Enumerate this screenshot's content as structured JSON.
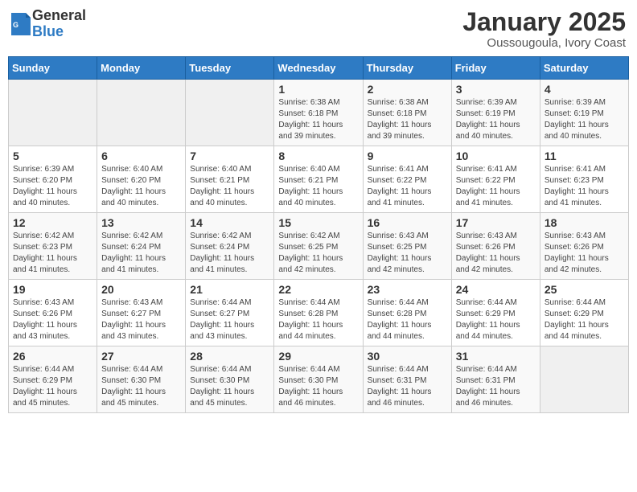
{
  "header": {
    "logo_general": "General",
    "logo_blue": "Blue",
    "title": "January 2025",
    "subtitle": "Oussougoula, Ivory Coast"
  },
  "weekdays": [
    "Sunday",
    "Monday",
    "Tuesday",
    "Wednesday",
    "Thursday",
    "Friday",
    "Saturday"
  ],
  "weeks": [
    [
      {
        "day": "",
        "info": ""
      },
      {
        "day": "",
        "info": ""
      },
      {
        "day": "",
        "info": ""
      },
      {
        "day": "1",
        "info": "Sunrise: 6:38 AM\nSunset: 6:18 PM\nDaylight: 11 hours\nand 39 minutes."
      },
      {
        "day": "2",
        "info": "Sunrise: 6:38 AM\nSunset: 6:18 PM\nDaylight: 11 hours\nand 39 minutes."
      },
      {
        "day": "3",
        "info": "Sunrise: 6:39 AM\nSunset: 6:19 PM\nDaylight: 11 hours\nand 40 minutes."
      },
      {
        "day": "4",
        "info": "Sunrise: 6:39 AM\nSunset: 6:19 PM\nDaylight: 11 hours\nand 40 minutes."
      }
    ],
    [
      {
        "day": "5",
        "info": "Sunrise: 6:39 AM\nSunset: 6:20 PM\nDaylight: 11 hours\nand 40 minutes."
      },
      {
        "day": "6",
        "info": "Sunrise: 6:40 AM\nSunset: 6:20 PM\nDaylight: 11 hours\nand 40 minutes."
      },
      {
        "day": "7",
        "info": "Sunrise: 6:40 AM\nSunset: 6:21 PM\nDaylight: 11 hours\nand 40 minutes."
      },
      {
        "day": "8",
        "info": "Sunrise: 6:40 AM\nSunset: 6:21 PM\nDaylight: 11 hours\nand 40 minutes."
      },
      {
        "day": "9",
        "info": "Sunrise: 6:41 AM\nSunset: 6:22 PM\nDaylight: 11 hours\nand 41 minutes."
      },
      {
        "day": "10",
        "info": "Sunrise: 6:41 AM\nSunset: 6:22 PM\nDaylight: 11 hours\nand 41 minutes."
      },
      {
        "day": "11",
        "info": "Sunrise: 6:41 AM\nSunset: 6:23 PM\nDaylight: 11 hours\nand 41 minutes."
      }
    ],
    [
      {
        "day": "12",
        "info": "Sunrise: 6:42 AM\nSunset: 6:23 PM\nDaylight: 11 hours\nand 41 minutes."
      },
      {
        "day": "13",
        "info": "Sunrise: 6:42 AM\nSunset: 6:24 PM\nDaylight: 11 hours\nand 41 minutes."
      },
      {
        "day": "14",
        "info": "Sunrise: 6:42 AM\nSunset: 6:24 PM\nDaylight: 11 hours\nand 41 minutes."
      },
      {
        "day": "15",
        "info": "Sunrise: 6:42 AM\nSunset: 6:25 PM\nDaylight: 11 hours\nand 42 minutes."
      },
      {
        "day": "16",
        "info": "Sunrise: 6:43 AM\nSunset: 6:25 PM\nDaylight: 11 hours\nand 42 minutes."
      },
      {
        "day": "17",
        "info": "Sunrise: 6:43 AM\nSunset: 6:26 PM\nDaylight: 11 hours\nand 42 minutes."
      },
      {
        "day": "18",
        "info": "Sunrise: 6:43 AM\nSunset: 6:26 PM\nDaylight: 11 hours\nand 42 minutes."
      }
    ],
    [
      {
        "day": "19",
        "info": "Sunrise: 6:43 AM\nSunset: 6:26 PM\nDaylight: 11 hours\nand 43 minutes."
      },
      {
        "day": "20",
        "info": "Sunrise: 6:43 AM\nSunset: 6:27 PM\nDaylight: 11 hours\nand 43 minutes."
      },
      {
        "day": "21",
        "info": "Sunrise: 6:44 AM\nSunset: 6:27 PM\nDaylight: 11 hours\nand 43 minutes."
      },
      {
        "day": "22",
        "info": "Sunrise: 6:44 AM\nSunset: 6:28 PM\nDaylight: 11 hours\nand 44 minutes."
      },
      {
        "day": "23",
        "info": "Sunrise: 6:44 AM\nSunset: 6:28 PM\nDaylight: 11 hours\nand 44 minutes."
      },
      {
        "day": "24",
        "info": "Sunrise: 6:44 AM\nSunset: 6:29 PM\nDaylight: 11 hours\nand 44 minutes."
      },
      {
        "day": "25",
        "info": "Sunrise: 6:44 AM\nSunset: 6:29 PM\nDaylight: 11 hours\nand 44 minutes."
      }
    ],
    [
      {
        "day": "26",
        "info": "Sunrise: 6:44 AM\nSunset: 6:29 PM\nDaylight: 11 hours\nand 45 minutes."
      },
      {
        "day": "27",
        "info": "Sunrise: 6:44 AM\nSunset: 6:30 PM\nDaylight: 11 hours\nand 45 minutes."
      },
      {
        "day": "28",
        "info": "Sunrise: 6:44 AM\nSunset: 6:30 PM\nDaylight: 11 hours\nand 45 minutes."
      },
      {
        "day": "29",
        "info": "Sunrise: 6:44 AM\nSunset: 6:30 PM\nDaylight: 11 hours\nand 46 minutes."
      },
      {
        "day": "30",
        "info": "Sunrise: 6:44 AM\nSunset: 6:31 PM\nDaylight: 11 hours\nand 46 minutes."
      },
      {
        "day": "31",
        "info": "Sunrise: 6:44 AM\nSunset: 6:31 PM\nDaylight: 11 hours\nand 46 minutes."
      },
      {
        "day": "",
        "info": ""
      }
    ]
  ]
}
